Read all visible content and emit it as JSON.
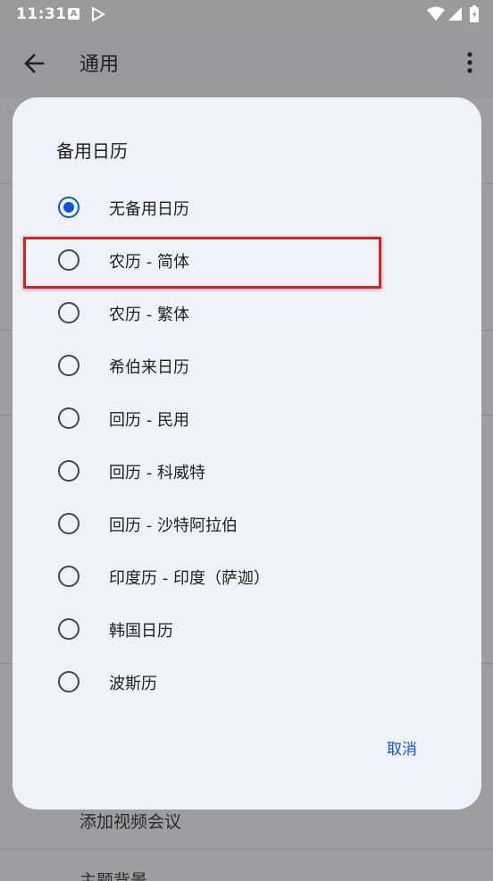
{
  "status_bar": {
    "time": "11:31",
    "a_icon_text": "A",
    "icons": [
      "a-notification-icon",
      "play-store-icon",
      "wifi-icon",
      "signal-icon",
      "battery-icon"
    ]
  },
  "app_bar": {
    "title": "通用",
    "back_icon": "back-arrow-icon",
    "more_icon": "more-vert-icon"
  },
  "background_list": {
    "items": [
      "添加视频会议",
      "主题背景"
    ]
  },
  "dialog": {
    "title": "备用日历",
    "options": [
      {
        "label": "无备用日历",
        "checked": true
      },
      {
        "label": "农历 - 简体",
        "checked": false
      },
      {
        "label": "农历 - 繁体",
        "checked": false
      },
      {
        "label": "希伯来日历",
        "checked": false
      },
      {
        "label": "回历 - 民用",
        "checked": false
      },
      {
        "label": "回历 - 科威特",
        "checked": false
      },
      {
        "label": "回历 - 沙特阿拉伯",
        "checked": false
      },
      {
        "label": "印度历 - 印度（萨迦）",
        "checked": false
      },
      {
        "label": "韩国日历",
        "checked": false
      },
      {
        "label": "波斯历",
        "checked": false
      }
    ],
    "cancel_label": "取消",
    "highlighted_option": "农历 - 简体"
  },
  "colors": {
    "accent": "#0b57d0",
    "highlight": "#d32424",
    "dialog_bg": "#eff2f8",
    "scrim_bg": "#9c9ea2"
  }
}
